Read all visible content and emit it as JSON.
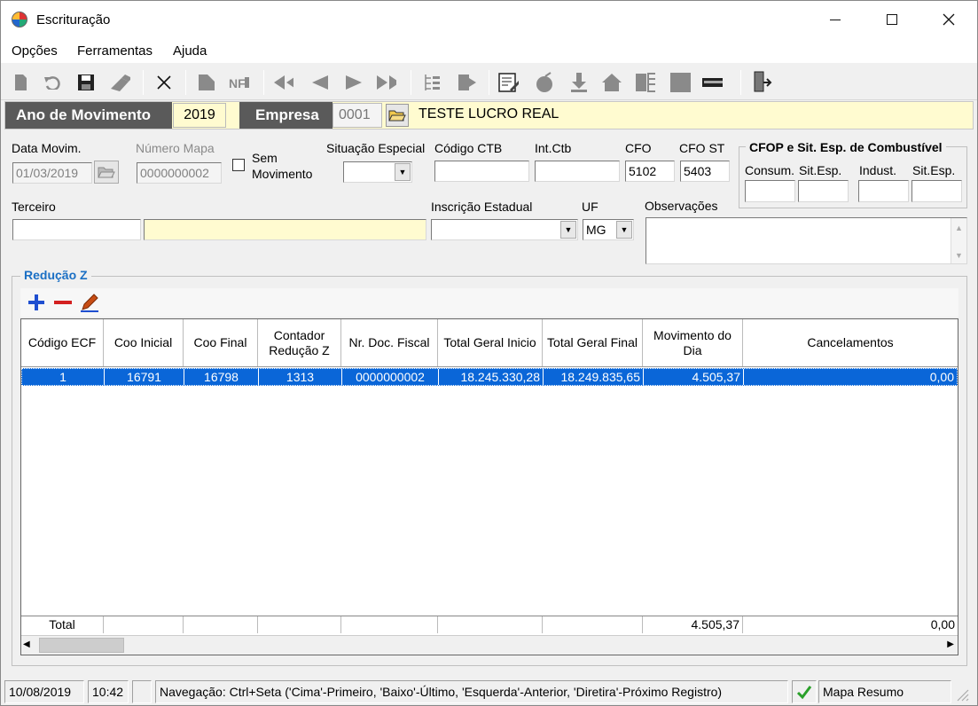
{
  "window": {
    "title": "Escrituração",
    "minimize": "—",
    "maximize": "☐",
    "close": "✕"
  },
  "menu": [
    "Opções",
    "Ferramentas",
    "Ajuda"
  ],
  "header": {
    "ano_label": "Ano de Movimento",
    "ano_value": "2019",
    "empresa_label": "Empresa",
    "empresa_code": "0001",
    "empresa_name": "TESTE LUCRO REAL"
  },
  "form": {
    "data_movim_label": "Data Movim.",
    "data_movim_value": "01/03/2019",
    "numero_mapa_label": "Número Mapa",
    "numero_mapa_value": "0000000002",
    "sem_movimento_label_1": "Sem",
    "sem_movimento_label_2": "Movimento",
    "situacao_especial_label": "Situação Especial",
    "situacao_especial_value": "",
    "codigo_ctb_label": "Código CTB",
    "codigo_ctb_value": "",
    "int_ctb_label": "Int.Ctb",
    "int_ctb_value": "",
    "cfo_label": "CFO",
    "cfo_value": "5102",
    "cfo_st_label": "CFO ST",
    "cfo_st_value": "5403",
    "terceiro_label": "Terceiro",
    "terceiro_code": "",
    "terceiro_name": "",
    "inscricao_label": "Inscrição Estadual",
    "inscricao_value": "",
    "uf_label": "UF",
    "uf_value": "MG",
    "observacoes_label": "Observações",
    "observacoes_value": ""
  },
  "cfop_group": {
    "title": "CFOP e Sit. Esp. de Combustível",
    "consum_label": "Consum.",
    "sitesp1_label": "Sit.Esp.",
    "indust_label": "Indust.",
    "sitesp2_label": "Sit.Esp."
  },
  "reducao": {
    "title": "Redução Z",
    "columns": [
      "Código ECF",
      "Coo Inicial",
      "Coo Final",
      "Contador Redução Z",
      "Nr. Doc. Fiscal",
      "Total Geral Inicio",
      "Total Geral Final",
      "Movimento do Dia",
      "Cancelamentos"
    ],
    "rows": [
      [
        "1",
        "16791",
        "16798",
        "1313",
        "0000000002",
        "18.245.330,28",
        "18.249.835,65",
        "4.505,37",
        "0,00"
      ]
    ],
    "footer": {
      "label": "Total",
      "movimento": "4.505,37",
      "cancelamentos": "0,00"
    }
  },
  "status": {
    "date": "10/08/2019",
    "time": "10:42",
    "navigation": "Navegação: Ctrl+Seta ('Cima'-Primeiro, 'Baixo'-Último, 'Esquerda'-Anterior, 'Diretira'-Próximo Registro)",
    "module": "Mapa Resumo"
  },
  "colors": {
    "accent_blue": "#0a66d8",
    "header_dark": "#5a5a5a",
    "field_yellow": "#fffbd0",
    "group_title_blue": "#1a6fc4"
  }
}
